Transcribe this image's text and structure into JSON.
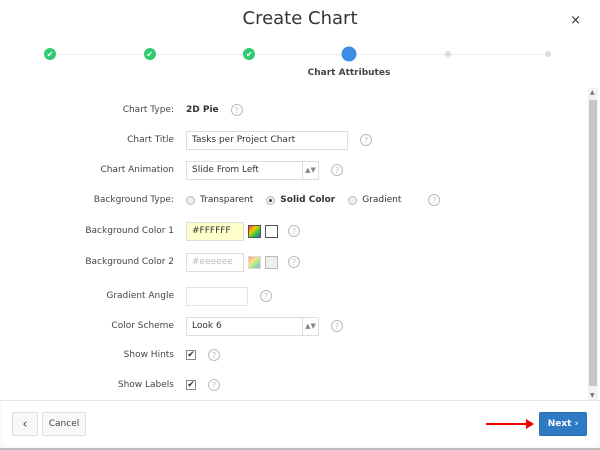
{
  "dialog": {
    "title": "Create Chart",
    "close_label": "×"
  },
  "wizard": {
    "current_step_label": "Chart Attributes",
    "steps": [
      "done",
      "done",
      "done",
      "current",
      "todo",
      "todo"
    ]
  },
  "form": {
    "chart_type": {
      "label": "Chart Type:",
      "value": "2D Pie"
    },
    "chart_title": {
      "label": "Chart Title",
      "value": "Tasks per Project Chart"
    },
    "chart_animation": {
      "label": "Chart Animation",
      "value": "Slide From Left"
    },
    "background_type": {
      "label": "Background Type:",
      "options": [
        "Transparent",
        "Solid Color",
        "Gradient"
      ],
      "selected": "Solid Color"
    },
    "background_color_1": {
      "label": "Background Color 1",
      "value": "#FFFFFF",
      "swatch": "#ffffff"
    },
    "background_color_2": {
      "label": "Background Color 2",
      "placeholder": "#eeeeee",
      "swatch": "#eeeeee"
    },
    "gradient_angle": {
      "label": "Gradient Angle",
      "value": ""
    },
    "color_scheme": {
      "label": "Color Scheme",
      "value": "Look 6"
    },
    "show_hints": {
      "label": "Show Hints",
      "checked": true
    },
    "show_labels": {
      "label": "Show Labels",
      "checked": true
    },
    "help": "?"
  },
  "footer": {
    "back_label": "‹",
    "cancel_label": "Cancel",
    "next_label": "Next ›"
  },
  "colors": {
    "accent": "#2d7bc4",
    "done": "#2ecc71",
    "current": "#3a8ee6",
    "highlight": "#ffffcc",
    "arrow": "#e00000"
  }
}
